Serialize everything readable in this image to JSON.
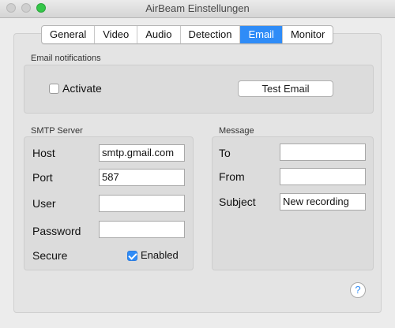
{
  "window": {
    "title": "AirBeam Einstellungen"
  },
  "tabs": [
    {
      "label": "General"
    },
    {
      "label": "Video"
    },
    {
      "label": "Audio"
    },
    {
      "label": "Detection"
    },
    {
      "label": "Email",
      "active": true
    },
    {
      "label": "Monitor"
    }
  ],
  "email_notifications": {
    "title": "Email notifications",
    "activate_label": "Activate",
    "activate_checked": false,
    "test_button": "Test Email"
  },
  "smtp": {
    "title": "SMTP Server",
    "host_label": "Host",
    "host_value": "smtp.gmail.com",
    "port_label": "Port",
    "port_value": "587",
    "user_label": "User",
    "user_value": "",
    "password_label": "Password",
    "password_value": "",
    "secure_label": "Secure",
    "secure_checkbox_label": "Enabled",
    "secure_checked": true
  },
  "message": {
    "title": "Message",
    "to_label": "To",
    "to_value": "",
    "from_label": "From",
    "from_value": "",
    "subject_label": "Subject",
    "subject_value": "New recording"
  },
  "help": {
    "glyph": "?"
  },
  "colors": {
    "accent": "#2f8cf7",
    "zoom_button": "#35c649"
  }
}
